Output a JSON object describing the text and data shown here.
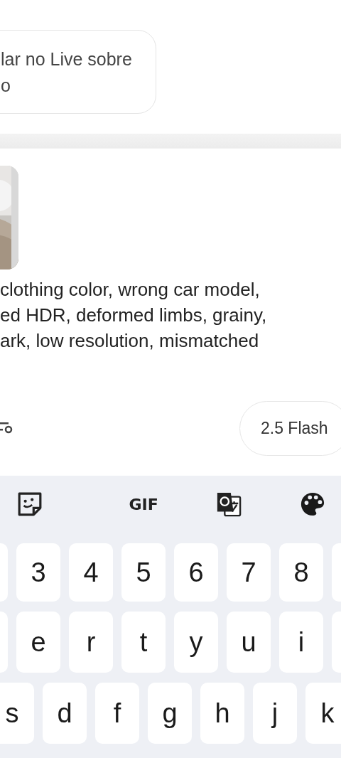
{
  "chat_bubble": {
    "lines": [
      "lar no Live sobre",
      "o"
    ]
  },
  "composer": {
    "attachment": {
      "kind": "picture"
    },
    "prompt_lines": [
      "clothing color, wrong car model,",
      "ed HDR, deformed limbs, grainy,",
      "ark, low resolution, mismatched"
    ],
    "model_button": "2.5 Flash"
  },
  "keyboard": {
    "toolbar": [
      {
        "kind": "sticker"
      },
      {
        "kind": "gif",
        "label": "GIF"
      },
      {
        "kind": "translate"
      },
      {
        "kind": "palette"
      }
    ],
    "rows": [
      {
        "keys": [
          "3",
          "4",
          "5",
          "6",
          "7",
          "8"
        ]
      },
      {
        "keys": [
          "e",
          "r",
          "t",
          "y",
          "u",
          "i"
        ]
      },
      {
        "keys": [
          "s",
          "d",
          "f",
          "g",
          "h",
          "j",
          "k"
        ]
      }
    ]
  }
}
